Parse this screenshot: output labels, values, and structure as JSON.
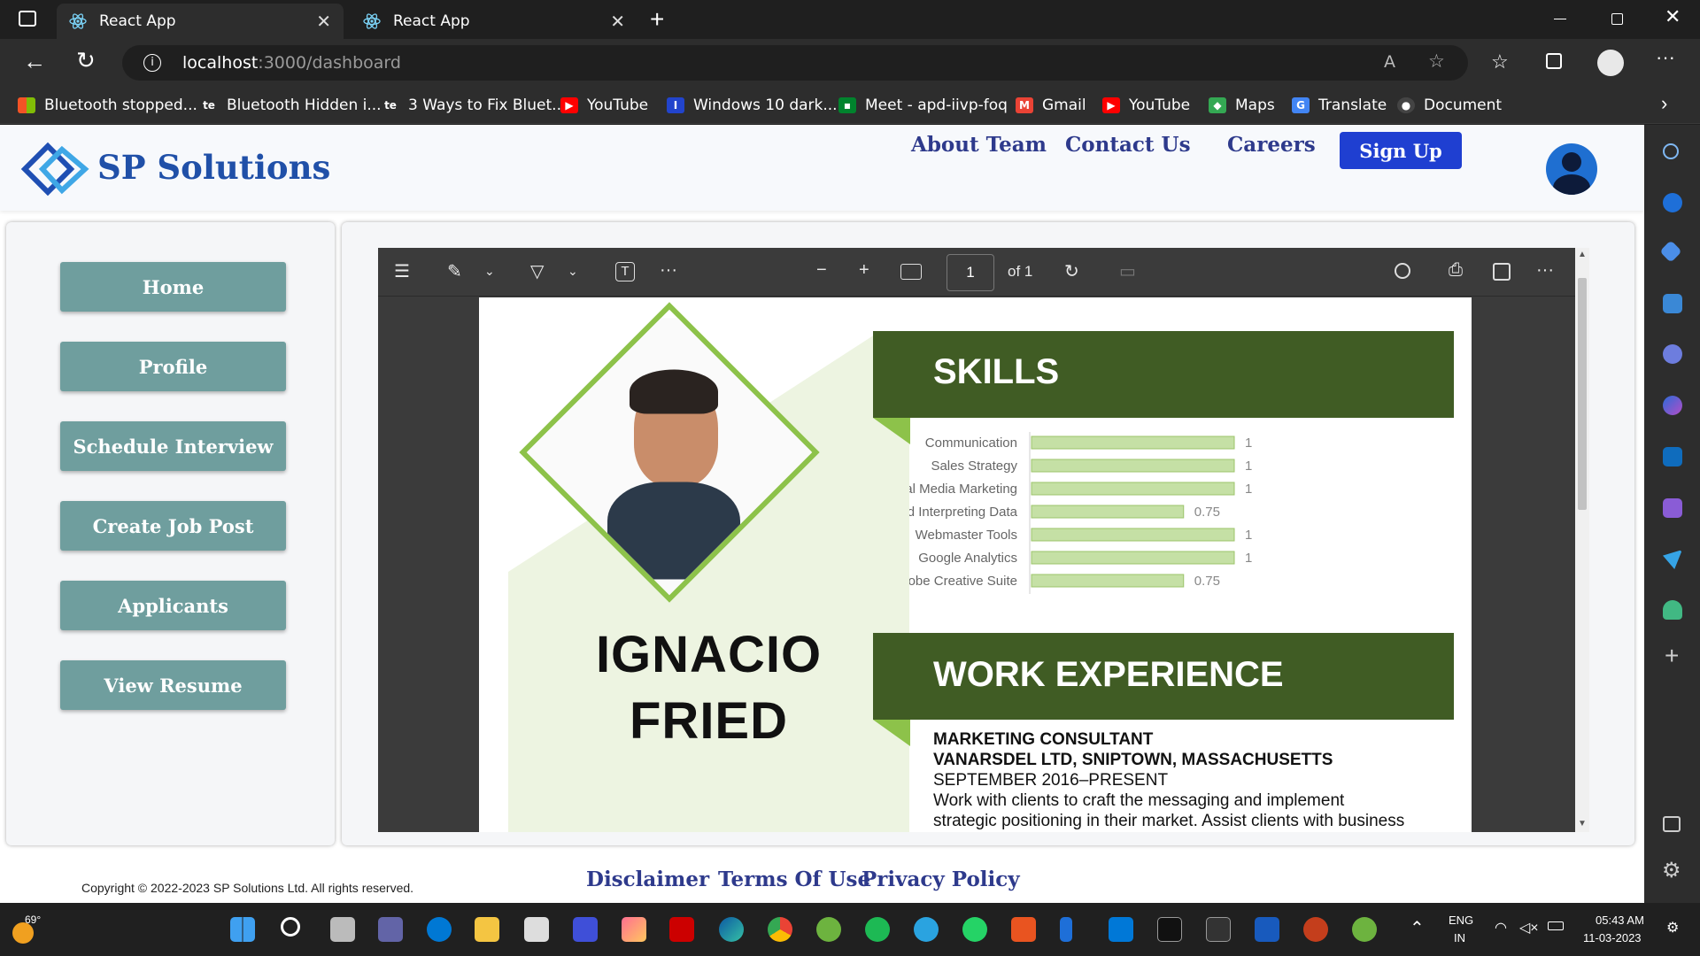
{
  "browser": {
    "tabs": [
      {
        "title": "React App",
        "active": true
      },
      {
        "title": "React App",
        "active": false
      }
    ],
    "url_host": "localhost",
    "url_rest": ":3000/dashboard",
    "bookmarks": [
      {
        "label": "Bluetooth stopped...",
        "icon": "windows-icon"
      },
      {
        "label": "Bluetooth Hidden i...",
        "icon": "te-icon"
      },
      {
        "label": "3 Ways to Fix Bluet...",
        "icon": "te-icon"
      },
      {
        "label": "YouTube",
        "icon": "youtube-icon"
      },
      {
        "label": "Windows 10 dark...",
        "icon": "info-icon"
      },
      {
        "label": "Meet - apd-iivp-foq",
        "icon": "meet-icon"
      },
      {
        "label": "Gmail",
        "icon": "gmail-icon"
      },
      {
        "label": "YouTube",
        "icon": "youtube-icon"
      },
      {
        "label": "Maps",
        "icon": "maps-icon"
      },
      {
        "label": "Translate",
        "icon": "translate-icon"
      },
      {
        "label": "Document",
        "icon": "github-icon"
      }
    ]
  },
  "site": {
    "brand": "SP Solutions",
    "nav": [
      "About Team",
      "Contact Us",
      "Careers"
    ],
    "signup": "Sign Up",
    "sidebar": [
      "Home",
      "Profile",
      "Schedule Interview",
      "Create Job Post",
      "Applicants",
      "View Resume"
    ],
    "footer": {
      "copyright": "Copyright © 2022-2023 SP Solutions Ltd. All rights reserved.",
      "links": [
        "Disclaimer",
        "Terms Of Use",
        "Privacy Policy"
      ]
    }
  },
  "pdf_viewer": {
    "page_current": "1",
    "page_total": "of 1"
  },
  "resume": {
    "first_name": "IGNACIO",
    "last_name": "FRIED",
    "skills_heading": "SKILLS",
    "skills": [
      {
        "name": "Communication",
        "level": 1,
        "label": "1"
      },
      {
        "name": "Sales Strategy",
        "level": 1,
        "label": "1"
      },
      {
        "name": "Social Media Marketing",
        "level": 1,
        "label": "1"
      },
      {
        "name": "Gathering And Interpreting Data",
        "level": 0.75,
        "label": "0.75"
      },
      {
        "name": "Webmaster Tools",
        "level": 1,
        "label": "1"
      },
      {
        "name": "Google Analytics",
        "level": 1,
        "label": "1"
      },
      {
        "name": "Adobe Creative Suite",
        "level": 0.75,
        "label": "0.75"
      }
    ],
    "work_heading": "WORK EXPERIENCE",
    "job_title": "MARKETING CONSULTANT",
    "company": "VANARSDEL LTD, SNIPTOWN, MASSACHUSETTS",
    "dates": "SEPTEMBER 2016–PRESENT",
    "desc1": "Work with clients to craft the messaging and implement",
    "desc2": "strategic positioning in their market. Assist clients with business"
  },
  "taskbar": {
    "weather": "69°",
    "lang1": "ENG",
    "lang2": "IN",
    "time": "05:43 AM",
    "date": "11-03-2023"
  },
  "colors": {
    "accent_green_dark": "#405c24",
    "accent_green_light": "#8dc24a",
    "bar_green": "#c5e0a5",
    "sidebar_button": "#6f9e9e",
    "nav_text": "#2e3a8c",
    "signup_bg": "#1f3fd1"
  }
}
